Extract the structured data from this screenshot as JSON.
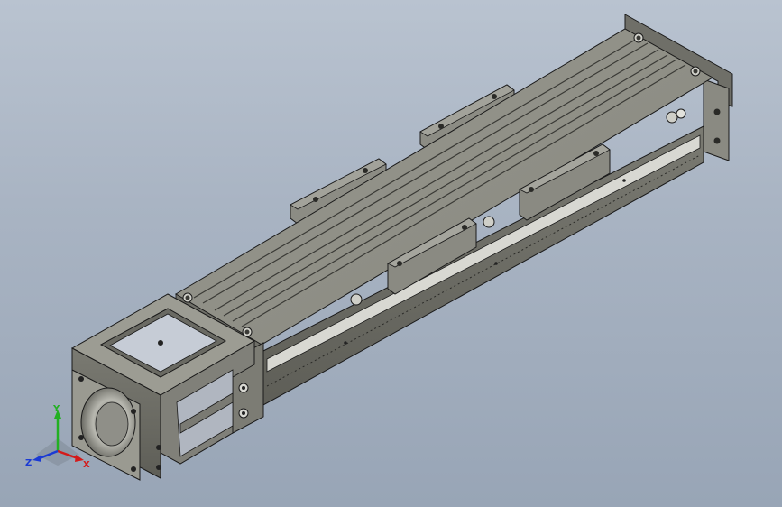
{
  "viewport": {
    "background_top": "#b9c3d0",
    "background_bottom": "#98a5b6",
    "part_color": "#8e8e84",
    "part_light": "#a7a79e",
    "part_dark": "#55554f",
    "edge_color": "#1a1a1a",
    "slot_color": "#3a3a36"
  },
  "triad": {
    "x_label": "X",
    "y_label": "Y",
    "z_label": "Z",
    "x_color": "#d41a1a",
    "y_color": "#22b022",
    "z_color": "#1a3ad4"
  },
  "model": {
    "icon": "linear-actuator-model"
  }
}
